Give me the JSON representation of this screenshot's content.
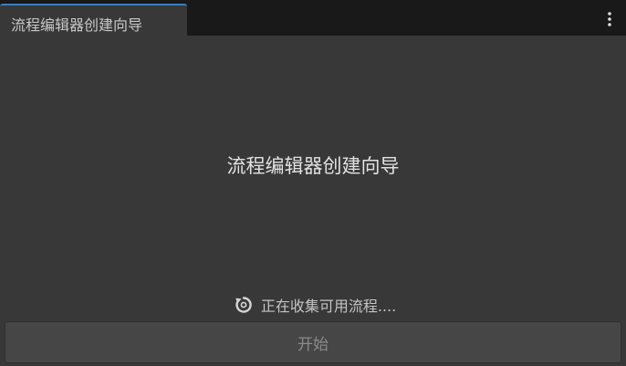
{
  "tab": {
    "title": "流程编辑器创建向导"
  },
  "header": {
    "menu_icon": "kebab-menu-icon"
  },
  "main": {
    "title": "流程编辑器创建向导"
  },
  "status": {
    "icon": "refresh-icon",
    "text": "正在收集可用流程...."
  },
  "actions": {
    "start_label": "开始",
    "start_enabled": false
  },
  "colors": {
    "background": "#383838",
    "tabbar": "#191919",
    "tab_accent": "#3d7ec4",
    "button": "#464646"
  }
}
